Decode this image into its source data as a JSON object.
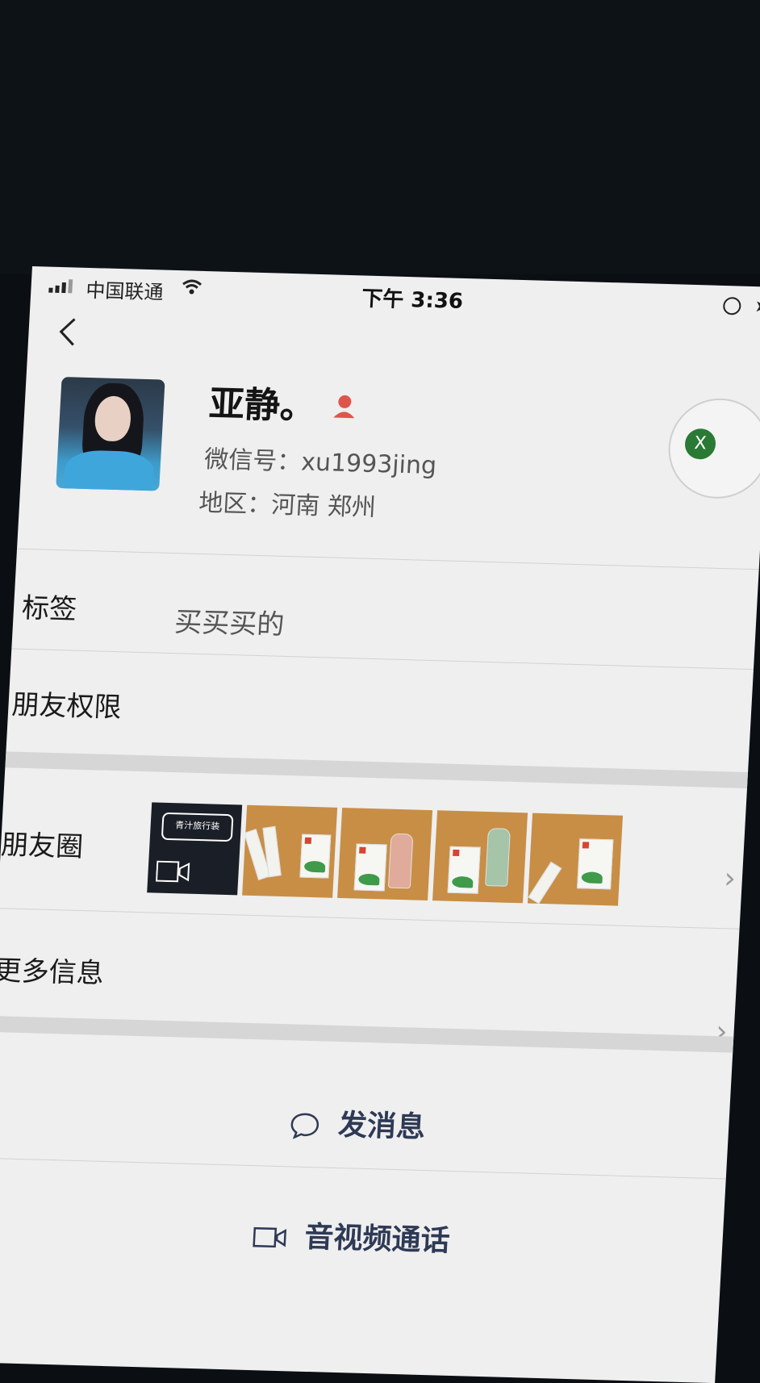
{
  "status_bar": {
    "carrier": "中国联通",
    "time": "下午 3:36"
  },
  "profile": {
    "name": "亚静。",
    "wechat_id": "微信号：xu1993jing",
    "region": "地区：河南 郑州",
    "side_badge": "X"
  },
  "rows": {
    "tags_label": "标签",
    "tags_value": "买买买的",
    "permissions_label": "朋友权限",
    "moments_label": "朋友圈",
    "more_label": "更多信息"
  },
  "moments": {
    "video_caption": "青汁旅行装"
  },
  "actions": {
    "message": "发消息",
    "call": "音视频通话"
  },
  "colors": {
    "accent_text": "#2e3a55",
    "gender_icon": "#e0554a",
    "badge": "#2a7a35"
  }
}
